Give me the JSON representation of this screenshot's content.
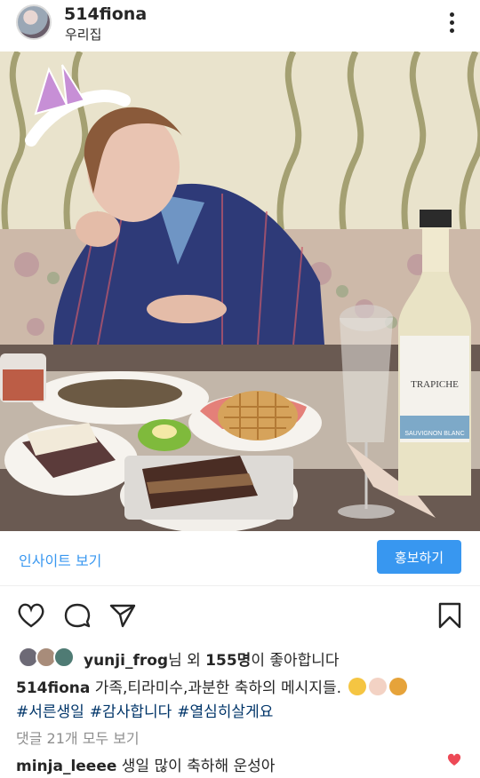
{
  "header": {
    "username": "514fiona",
    "location": "우리집",
    "avatar_icon": "profile-avatar",
    "more_icon": "more-vertical-icon"
  },
  "post": {
    "photo_label": "photo",
    "insights_label": "인사이트 보기",
    "promote_label": "홍보하기",
    "promote_color": "#3897f0"
  },
  "actions": {
    "like_icon": "heart-outline-icon",
    "comment_icon": "comment-icon",
    "share_icon": "send-icon",
    "save_icon": "bookmark-icon"
  },
  "likes": {
    "first_user": "yunji_frog",
    "rest": "님 외 ",
    "count": "155명",
    "suffix": "이 좋아합니다"
  },
  "caption": {
    "username": "514fiona",
    "text": " 가족,티라미수,과분한 축하의 메시지들.",
    "emoji_icons": [
      "sleepy-face-icon",
      "birthday-cake-icon",
      "bouquet-icon"
    ],
    "hashtags": [
      "#서른생일",
      "#감사합니다",
      "#열심히살게요"
    ]
  },
  "comments": {
    "view_all": "댓글 21개 모두 보기",
    "top_comment": {
      "username": "minja_leeee",
      "text": " 생일 많이 축하해 운성아",
      "heart_color": "#ed4956"
    }
  }
}
